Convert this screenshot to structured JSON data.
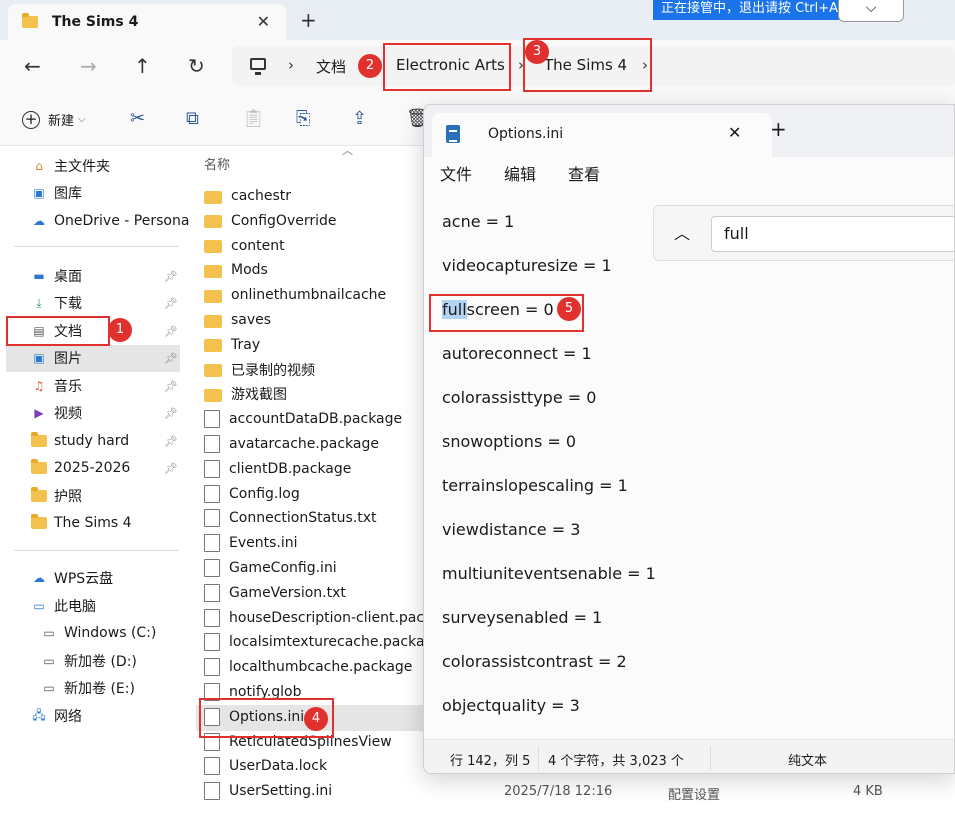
{
  "explorer": {
    "tab_title": "The Sims 4",
    "banner_text": "正在接管中，退出请按 Ctrl+Alt+",
    "breadcrumbs": [
      "文档",
      "Electronic Arts",
      "The Sims 4"
    ],
    "toolbar": {
      "new_label": "新建"
    },
    "sidebar": {
      "top": [
        {
          "label": "主文件夹",
          "icon": "home-icon"
        },
        {
          "label": "图库",
          "icon": "gallery-icon"
        },
        {
          "label": "OneDrive - Persona",
          "icon": "cloud-icon"
        }
      ],
      "pinned": [
        {
          "label": "桌面",
          "icon": "desktop-icon"
        },
        {
          "label": "下载",
          "icon": "download-icon"
        },
        {
          "label": "文档",
          "icon": "document-icon"
        },
        {
          "label": "图片",
          "icon": "picture-icon"
        },
        {
          "label": "音乐",
          "icon": "music-icon"
        },
        {
          "label": "视频",
          "icon": "video-icon"
        },
        {
          "label": "study hard",
          "icon": "folder-icon"
        },
        {
          "label": "2025-2026",
          "icon": "folder-icon"
        },
        {
          "label": "护照",
          "icon": "folder-icon"
        },
        {
          "label": "The Sims 4",
          "icon": "folder-icon"
        }
      ],
      "bottom": [
        {
          "label": "WPS云盘",
          "icon": "cloud-icon"
        },
        {
          "label": "此电脑",
          "icon": "computer-icon"
        },
        {
          "label": "Windows (C:)",
          "icon": "drive-icon"
        },
        {
          "label": "新加卷 (D:)",
          "icon": "drive-icon"
        },
        {
          "label": "新加卷 (E:)",
          "icon": "drive-icon"
        },
        {
          "label": "网络",
          "icon": "network-icon"
        }
      ]
    },
    "column_header": "名称",
    "files": [
      {
        "name": "cachestr",
        "type": "folder"
      },
      {
        "name": "ConfigOverride",
        "type": "folder"
      },
      {
        "name": "content",
        "type": "folder"
      },
      {
        "name": "Mods",
        "type": "folder"
      },
      {
        "name": "onlinethumbnailcache",
        "type": "folder"
      },
      {
        "name": "saves",
        "type": "folder"
      },
      {
        "name": "Tray",
        "type": "folder"
      },
      {
        "name": "已录制的视频",
        "type": "folder"
      },
      {
        "name": "游戏截图",
        "type": "folder"
      },
      {
        "name": "accountDataDB.package",
        "type": "file"
      },
      {
        "name": "avatarcache.package",
        "type": "file"
      },
      {
        "name": "clientDB.package",
        "type": "file"
      },
      {
        "name": "Config.log",
        "type": "file"
      },
      {
        "name": "ConnectionStatus.txt",
        "type": "file"
      },
      {
        "name": "Events.ini",
        "type": "file"
      },
      {
        "name": "GameConfig.ini",
        "type": "file"
      },
      {
        "name": "GameVersion.txt",
        "type": "file"
      },
      {
        "name": "houseDescription-client.packa",
        "type": "file"
      },
      {
        "name": "localsimtexturecache.packag",
        "type": "file"
      },
      {
        "name": "localthumbcache.package",
        "type": "file"
      },
      {
        "name": "notify.glob",
        "type": "file"
      },
      {
        "name": "Options.ini",
        "type": "file"
      },
      {
        "name": "ReticulatedSplinesView",
        "type": "file"
      },
      {
        "name": "UserData.lock",
        "type": "file"
      },
      {
        "name": "UserSetting.ini",
        "type": "file"
      }
    ],
    "last_row_meta": {
      "date": "2025/7/18 12:16",
      "type": "配置设置",
      "size": "4 KB"
    }
  },
  "notepad": {
    "tab_title": "Options.ini",
    "menu": [
      "文件",
      "编辑",
      "查看"
    ],
    "search_text": "full",
    "highlight": "full",
    "lines": [
      "acne = 1",
      "videocapturesize = 1",
      "fullscreen = 0",
      "autoreconnect = 1",
      "colorassisttype = 0",
      "snowoptions = 0",
      "terrainslopescaling = 1",
      "viewdistance = 3",
      "multiuniteventsenable = 1",
      "surveysenabled = 1",
      "colorassistcontrast = 2",
      "objectquality = 3"
    ],
    "line3_rest": "screen = 0",
    "status": {
      "position": "行 142，列 5",
      "chars": "4 个字符，共 3,023 个",
      "encoding": "纯文本"
    }
  },
  "annotations": [
    "1",
    "2",
    "3",
    "4",
    "5"
  ],
  "colors": {
    "annotation_red": "#e0312f",
    "selection": "#e5e5e5",
    "highlight": "#b3d3f2"
  }
}
